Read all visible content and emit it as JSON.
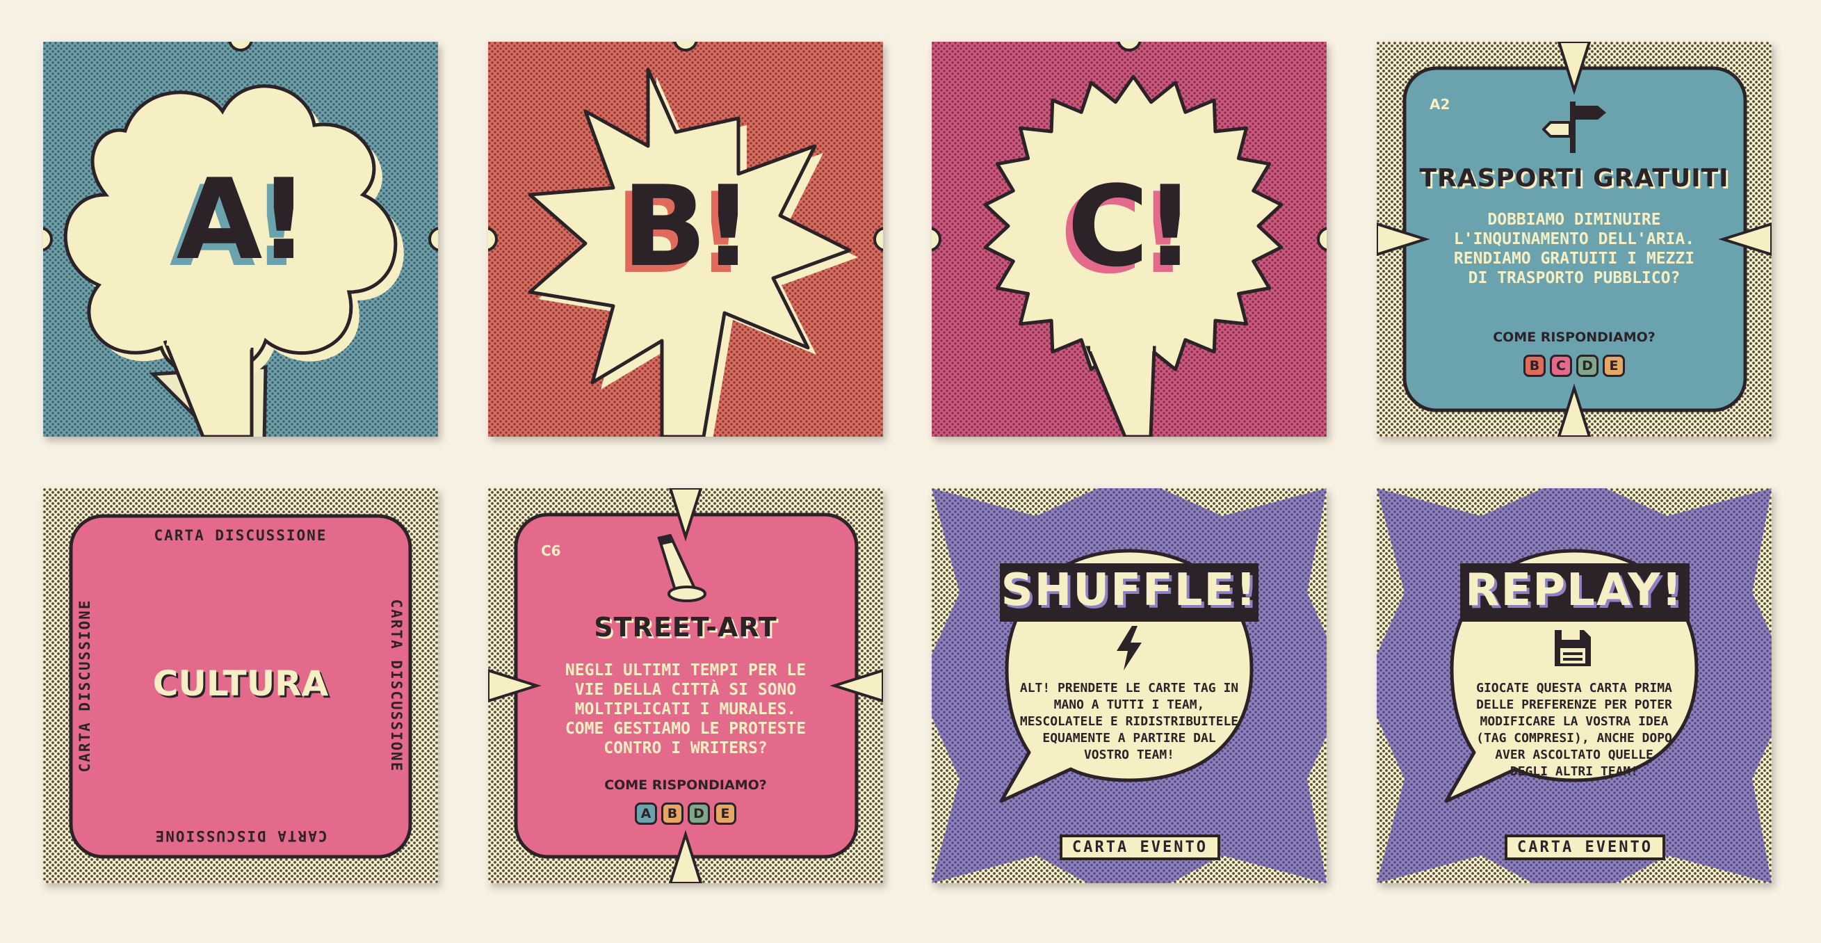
{
  "colors": {
    "background": "#f6f1e3",
    "blue": "#6aa3ae",
    "red": "#e06a5c",
    "magenta": "#d4567f",
    "pink": "#e46a8c",
    "purple": "#8d80c4",
    "cream": "#f6efc4",
    "ink": "#2b2328"
  },
  "cards": {
    "a": {
      "letter": "A!"
    },
    "b": {
      "letter": "B!"
    },
    "c": {
      "letter": "C!"
    },
    "transporti": {
      "code": "A2",
      "icon": "signpost-icon",
      "title": "TRASPORTI GRATUITI",
      "body": [
        "DOBBIAMO DIMINUIRE",
        "L'INQUINAMENTO DELL'ARIA.",
        "RENDIAMO GRATUITI I MEZZI",
        "DI TRASPORTO PUBBLICO?"
      ],
      "question": "COME RISPONDIAMO?",
      "tags": [
        {
          "label": "B",
          "color": "#e06a5c"
        },
        {
          "label": "C",
          "color": "#e46a8c"
        },
        {
          "label": "D",
          "color": "#6aa3ae"
        },
        {
          "label": "E",
          "color": "#e6a766"
        }
      ]
    },
    "cultura": {
      "top": "CARTA DISCUSSIONE",
      "left": "CARTA DISCUSSIONE",
      "right": "CARTA DISCUSSIONE",
      "bottom": "CARTA DISCUSSIONE",
      "title": "CULTURA"
    },
    "streetart": {
      "code": "C6",
      "icon": "spotlight-icon",
      "title": "STREET-ART",
      "body": [
        "NEGLI ULTIMI TEMPI PER LE",
        "VIE DELLA CITTÀ SI SONO",
        "MOLTIPLICATI I MURALES.",
        "COME GESTIAMO LE PROTESTE",
        "CONTRO I WRITERS?"
      ],
      "question": "COME RISPONDIAMO?",
      "tags": [
        {
          "label": "A",
          "color": "#6aa3ae"
        },
        {
          "label": "B",
          "color": "#e6a766"
        },
        {
          "label": "D",
          "color": "#7fa88a"
        },
        {
          "label": "E",
          "color": "#e6a766"
        }
      ]
    },
    "shuffle": {
      "title": "SHUFFLE!",
      "icon": "lightning-icon",
      "body": [
        "ALT! PRENDETE LE CARTE TAG IN",
        "MANO A TUTTI I TEAM,",
        "MESCOLATELE E RIDISTRIBUITELE",
        "EQUAMENTE A PARTIRE DAL",
        "VOSTRO TEAM!"
      ],
      "badge": "CARTA EVENTO"
    },
    "replay": {
      "title": "REPLAY!",
      "icon": "floppy-disk-icon",
      "body": [
        "GIOCATE QUESTA CARTA PRIMA",
        "DELLE PREFERENZE PER POTER",
        "MODIFICARE LA VOSTRA IDEA",
        "(TAG COMPRESI), ANCHE DOPO",
        "AVER ASCOLTATO QUELLE",
        "DEGLI ALTRI TEAM!"
      ],
      "badge": "CARTA EVENTO"
    }
  }
}
